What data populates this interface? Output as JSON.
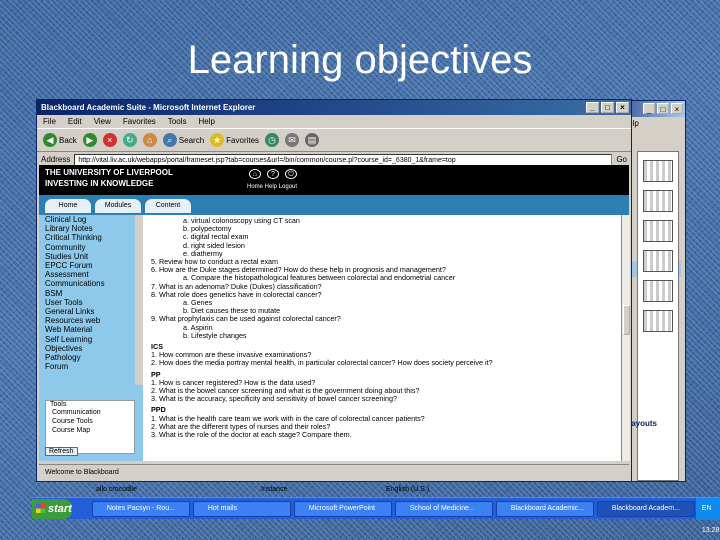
{
  "slide": {
    "title": "Learning objectives"
  },
  "bg_window": {
    "menu": "e help",
    "layouts": "layouts"
  },
  "window": {
    "title": "Blackboard Academic Suite - Microsoft Internet Explorer",
    "menu": [
      "File",
      "Edit",
      "View",
      "Favorites",
      "Tools",
      "Help"
    ],
    "toolbar": {
      "back": "Back",
      "search": "Search",
      "favorites": "Favorites"
    },
    "address_label": "Address",
    "address": "http://vital.liv.ac.uk/webapps/portal/frameset.jsp?tab=courses&url=/bin/common/course.pl?course_id=_6380_1&frame=top",
    "go": "Go",
    "brand_line1": "THE UNIVERSITY OF LIVERPOOL",
    "brand_line2": "INVESTING IN KNOWLEDGE",
    "header_icons": "Home   Help   Logout",
    "tabs": [
      "Home",
      "Modules",
      "Content"
    ],
    "sidebar": [
      "Clinical Log",
      "Library Notes",
      "Critical Thinking",
      "Community",
      "Studies Unit",
      "EPCC Forum",
      "Assessment",
      "Communications",
      "BSM",
      "User Tools",
      "General Links",
      "Resources web",
      "Web Material",
      "Self Learning",
      "Objectives",
      "Pathology",
      "Forum"
    ],
    "tools": {
      "heading": "Tools",
      "items": [
        "Communication",
        "Course Tools",
        "Course Map"
      ]
    },
    "refresh": "Refresh",
    "content": [
      {
        "k": "sub",
        "t": "a.  virtual colonoscopy using CT scan"
      },
      {
        "k": "sub",
        "t": "b.  polypectomy"
      },
      {
        "k": "sub",
        "t": "c.  digital rectal exam"
      },
      {
        "k": "sub",
        "t": "d.  right sided lesion"
      },
      {
        "k": "sub",
        "t": "e.  diathermy"
      },
      {
        "k": "num",
        "t": "5.  Review how to conduct a rectal exam"
      },
      {
        "k": "num",
        "t": "6.  How are the Duke stages determined? How do these help in prognosis and management?"
      },
      {
        "k": "sub",
        "t": "a.  Compare the histopathological features between colorectal and endometrial cancer"
      },
      {
        "k": "num",
        "t": "7.  What is an adenoma? Duke (Dukes) classification?"
      },
      {
        "k": "num",
        "t": "8.  What role does genetics have in colorectal cancer?"
      },
      {
        "k": "sub",
        "t": "a.  Genes"
      },
      {
        "k": "sub",
        "t": "b.  Diet causes these to mutate"
      },
      {
        "k": "num",
        "t": "9.  What prophylaxis can be used against colorectal cancer?"
      },
      {
        "k": "sub",
        "t": "a.  Aspirin"
      },
      {
        "k": "sub",
        "t": "b.  Lifestyle changes"
      },
      {
        "k": "head gap",
        "t": "ICS"
      },
      {
        "k": "num",
        "t": "1.  How common are these invasive examinations?"
      },
      {
        "k": "num",
        "t": "2.  How does the media portray mental health, in particular colorectal cancer? How does society perceive it?"
      },
      {
        "k": "head gap",
        "t": "PP"
      },
      {
        "k": "num",
        "t": "1.  How is cancer registered? How is the data used?"
      },
      {
        "k": "num",
        "t": "2.  What is the bowel cancer screening and what is the government doing about this?"
      },
      {
        "k": "num",
        "t": "3.  What is the accuracy, specificity and sensitivity of bowel cancer screening?"
      },
      {
        "k": "head gap",
        "t": "PPD"
      },
      {
        "k": "num",
        "t": "1.  What is the health care team we work with in the care of colorectal cancer patients?"
      },
      {
        "k": "num",
        "t": "2.  What are the different types of nurses and their roles?"
      },
      {
        "k": "num",
        "t": "3.  What is the role of the doctor at each stage? Compare them."
      }
    ],
    "status": "Welcome to Blackboard"
  },
  "desktop_row": [
    "allo crocodile",
    "Instance",
    "English (U.S.)"
  ],
  "taskbar": {
    "start": "start",
    "tasks": [
      "Notes Pacsyn - Rou...",
      "Hot mails",
      "Microsoft PowerPoint",
      "School of Medicine...",
      "Blackboard Academic...",
      "Blackboard Academ..."
    ],
    "tray": "EN  13:28"
  }
}
